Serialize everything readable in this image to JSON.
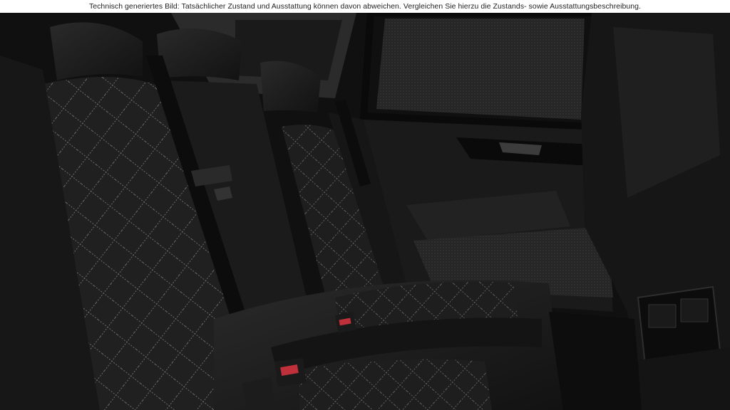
{
  "disclaimer": {
    "text": "Technisch generiertes Bild: Tatsächlicher Zustand und Ausstattung können davon abweichen. Vergleichen Sie hierzu die Zustands- sowie Ausstattungsbeschreibung."
  },
  "colors": {
    "leather": "#1c1c1c",
    "stitching": "#6a6a6a",
    "buckle_release": "#c0303a",
    "window_tint": "#2a2a2a",
    "trim": "#0a0a0a"
  },
  "icons": {
    "seat": "rear-bench-seat",
    "belt": "seat-belt-buckle"
  }
}
